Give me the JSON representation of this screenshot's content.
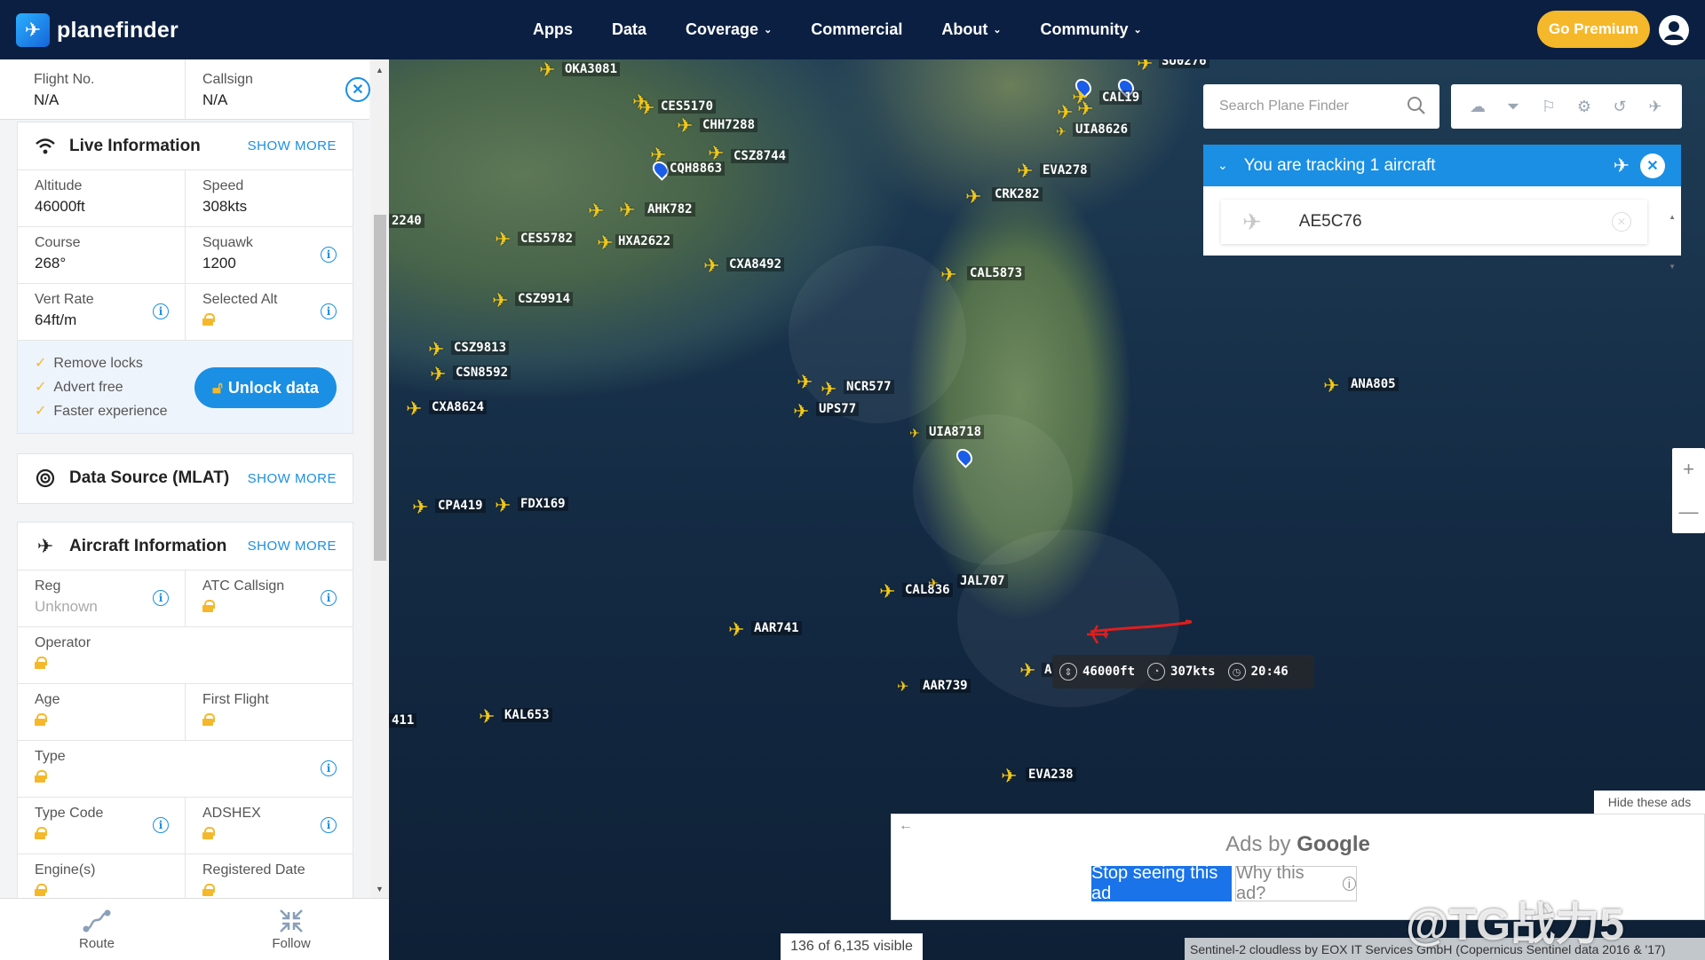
{
  "header": {
    "logo_text": "planefinder",
    "nav": [
      {
        "label": "Apps",
        "dropdown": false
      },
      {
        "label": "Data",
        "dropdown": false
      },
      {
        "label": "Coverage",
        "dropdown": true
      },
      {
        "label": "Commercial",
        "dropdown": false
      },
      {
        "label": "About",
        "dropdown": true
      },
      {
        "label": "Community",
        "dropdown": true
      }
    ],
    "premium_label": "Go Premium"
  },
  "sidebar": {
    "flight_no": {
      "label": "Flight No.",
      "value": "N/A"
    },
    "callsign": {
      "label": "Callsign",
      "value": "N/A"
    },
    "live": {
      "title": "Live Information",
      "show_more": "SHOW MORE",
      "altitude": {
        "label": "Altitude",
        "value": "46000ft"
      },
      "speed": {
        "label": "Speed",
        "value": "308kts"
      },
      "course": {
        "label": "Course",
        "value": "268°"
      },
      "squawk": {
        "label": "Squawk",
        "value": "1200"
      },
      "vert_rate": {
        "label": "Vert Rate",
        "value": "64ft/m"
      },
      "selected_alt": {
        "label": "Selected Alt"
      }
    },
    "promo": {
      "items": [
        "Remove locks",
        "Advert free",
        "Faster experience"
      ],
      "button": "Unlock data"
    },
    "data_source": {
      "title": "Data Source (MLAT)",
      "show_more": "SHOW MORE"
    },
    "aircraft": {
      "title": "Aircraft Information",
      "show_more": "SHOW MORE",
      "reg": {
        "label": "Reg",
        "value": "Unknown"
      },
      "atc_callsign": {
        "label": "ATC Callsign"
      },
      "operator": {
        "label": "Operator"
      },
      "age": {
        "label": "Age"
      },
      "first_flight": {
        "label": "First Flight"
      },
      "type": {
        "label": "Type"
      },
      "type_code": {
        "label": "Type Code"
      },
      "adshex": {
        "label": "ADSHEX"
      },
      "engines": {
        "label": "Engine(s)"
      },
      "registered_date": {
        "label": "Registered Date"
      }
    },
    "bottom": {
      "route": "Route",
      "follow": "Follow"
    }
  },
  "map": {
    "search_placeholder": "Search Plane Finder",
    "tools": [
      "cloud-icon",
      "filter-icon",
      "bookmark-icon",
      "gear-icon",
      "history-icon",
      "plane-alert-icon"
    ],
    "tracking": {
      "title": "You are tracking 1 aircraft",
      "aircraft": "AE5C76"
    },
    "aircraft_labels": [
      "OKA3081",
      "CES5170",
      "CHH7288",
      "CSZ8744",
      "CQH8863",
      "AHK782",
      "CES5782",
      "HXA2622",
      "CXA8492",
      "CSZ9914",
      "CSZ9813",
      "CSN8592",
      "CXA8624",
      "CPA419",
      "FDX169",
      "NCR577",
      "UPS77",
      "UIA8718",
      "CAL836",
      "JAL707",
      "AAR741",
      "AAR739",
      "KAL653",
      "EVA238",
      "EVA278",
      "CRK282",
      "CAL5873",
      "CAL19",
      "UIA8626",
      "SU0276",
      "ANA805",
      "2240",
      "411",
      "A"
    ],
    "tracked_info": {
      "altitude": "46000ft",
      "speed": "307kts",
      "time": "20:46"
    },
    "hide_ads": "Hide these ads",
    "ads_by": "Ads by",
    "ads_brand": "Google",
    "stop_ad": "Stop seeing this ad",
    "why_ad": "Why this ad?",
    "visible_count": "136 of 6,135 visible",
    "attribution": "Sentinel-2 cloudless by EOX IT Services GmbH (Copernicus Sentinel data 2016 & '17)",
    "watermark": "@TG战力5",
    "colors": {
      "plane": "#f2c919",
      "accent": "#1a8fe3",
      "premium": "#f5b82a",
      "track": "#e01e1e"
    }
  }
}
